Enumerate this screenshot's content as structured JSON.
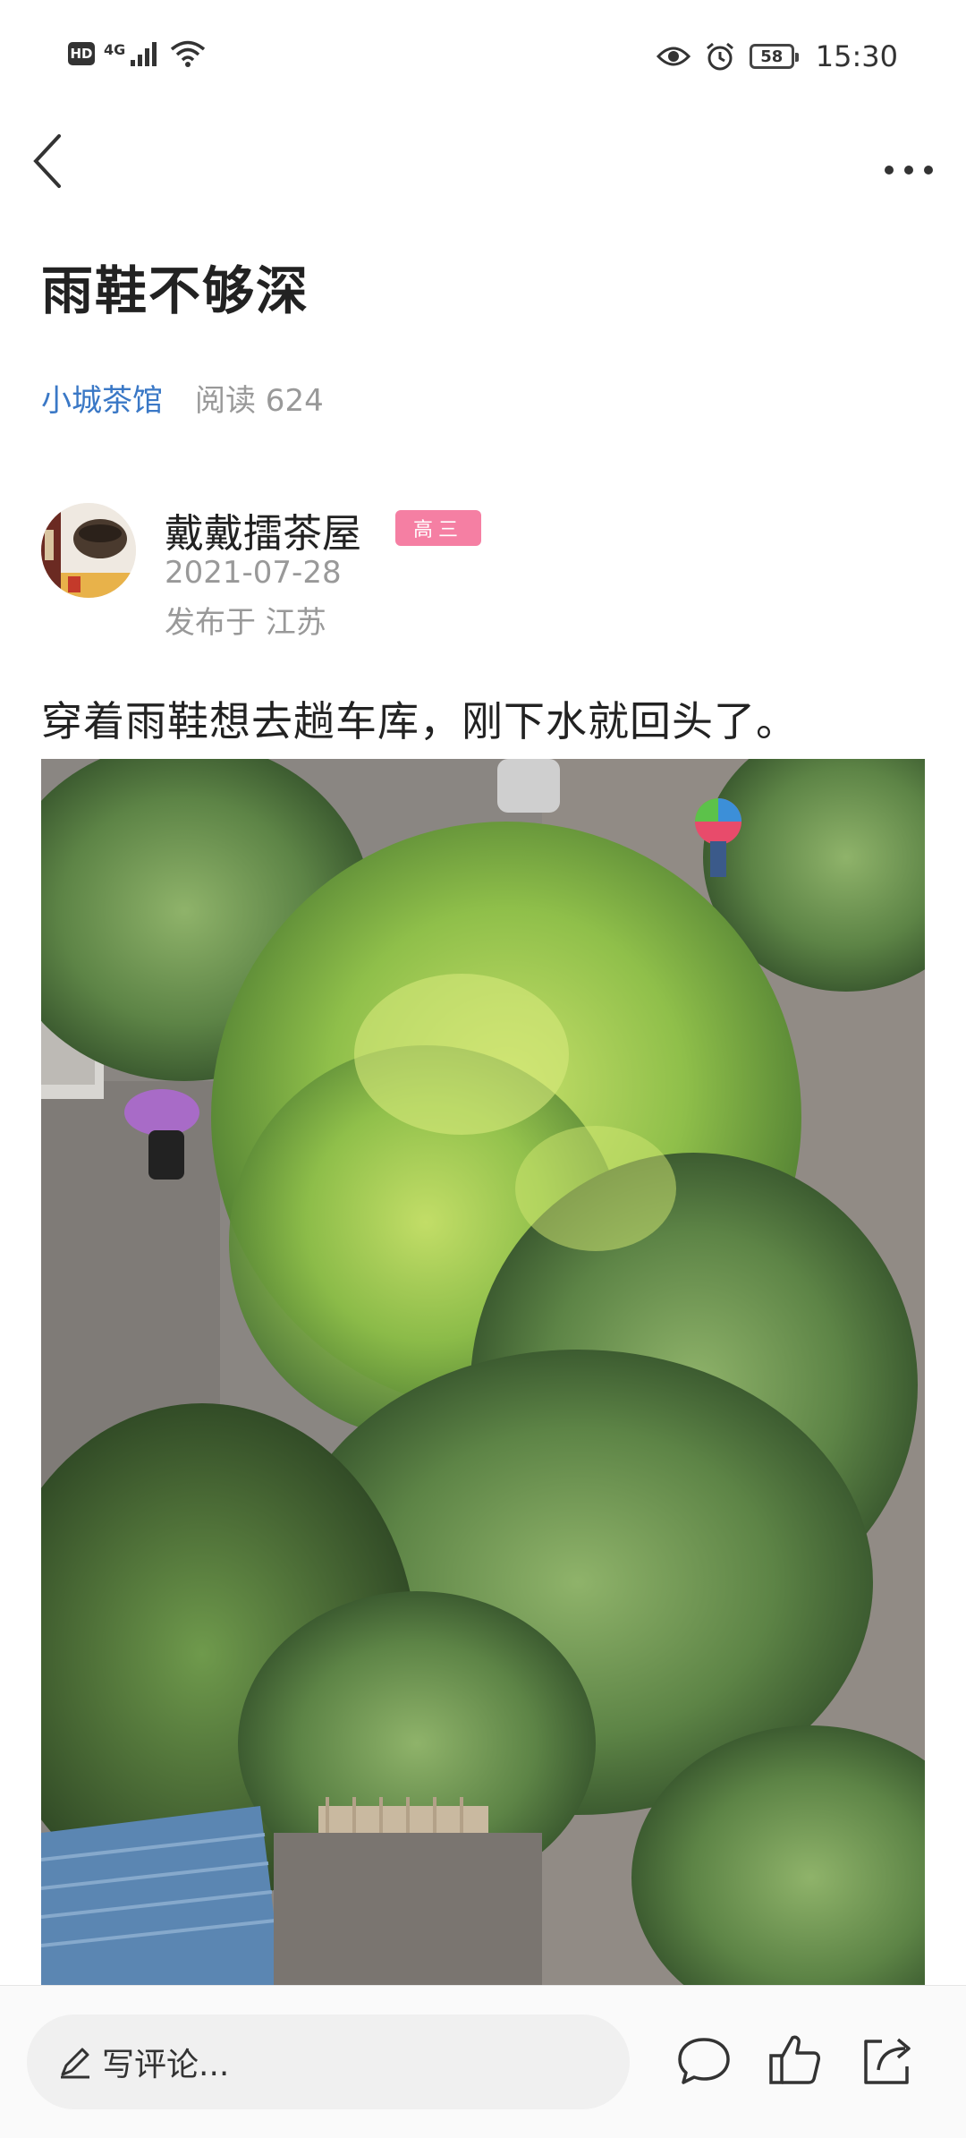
{
  "status_bar": {
    "left_badge": "HD",
    "network": "4G",
    "battery": "58",
    "time": "15:30"
  },
  "article": {
    "title": "雨鞋不够深",
    "channel": "小城茶馆",
    "reads": "阅读 624",
    "author": {
      "name": "戴戴擂茶屋",
      "badge": "高三",
      "date": "2021-07-28",
      "location": "发布于 江苏"
    },
    "text": "穿着雨鞋想去趟车库，刚下水就回头了。"
  },
  "bottom_bar": {
    "comment_placeholder": "写评论..."
  },
  "icons": {
    "back": "chevron-left-icon",
    "more": "more-dots-icon",
    "comment": "comment-bubble-icon",
    "like": "thumbs-up-icon",
    "share": "share-icon",
    "pen": "pen-icon"
  },
  "colors": {
    "channel_link": "#3a78c6",
    "badge": "#f57fa3",
    "meta_gray": "#999999"
  }
}
